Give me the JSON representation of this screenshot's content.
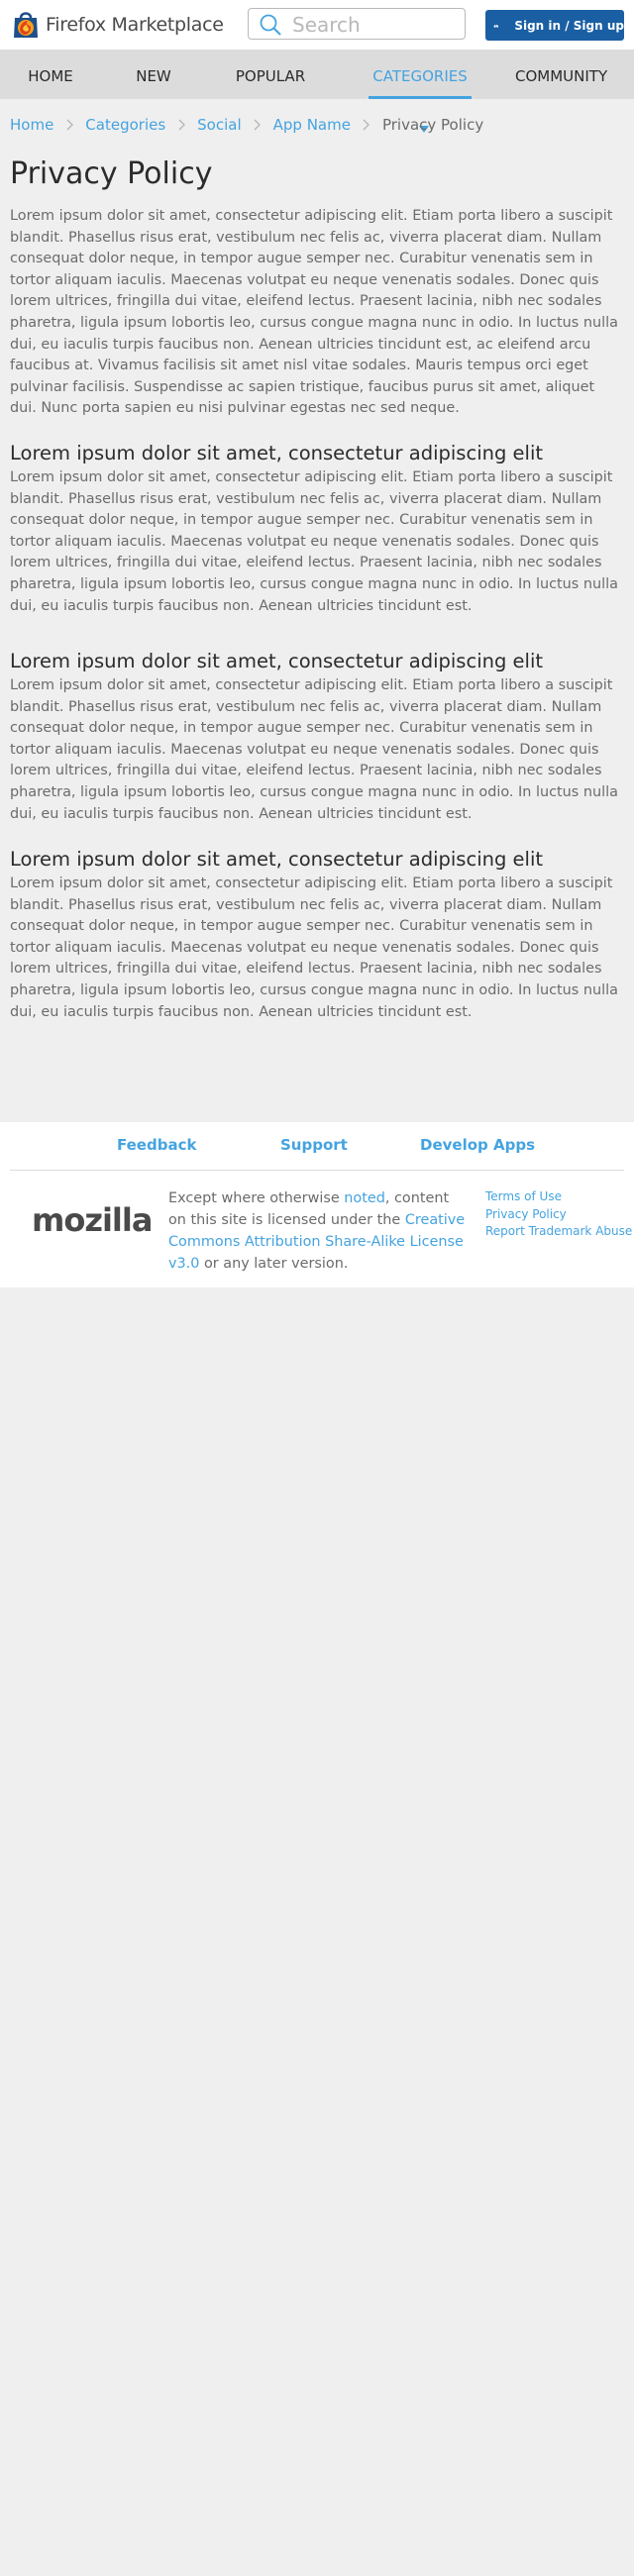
{
  "header": {
    "brand_text": "Firefox Marketplace",
    "search": {
      "placeholder": "Search",
      "value": ""
    },
    "signin_label": "Sign in / Sign up",
    "icons": {
      "logo": "firefox-marketplace-logo",
      "search": "search-icon",
      "signin": "user-cloud-icon"
    }
  },
  "nav": {
    "items": [
      {
        "label": "HOME",
        "active": false
      },
      {
        "label": "NEW",
        "active": false
      },
      {
        "label": "POPULAR",
        "active": false
      },
      {
        "label": "CATEGORIES",
        "active": true,
        "icon": "caret-down-icon"
      },
      {
        "label": "COMMUNITY",
        "active": false
      }
    ]
  },
  "breadcrumb": {
    "items": [
      "Home",
      "Categories",
      "Social",
      "App Name"
    ],
    "current": "Privacy Policy",
    "separator_icon": "chevron-right-icon"
  },
  "content": {
    "title": "Privacy Policy",
    "intro": "Lorem ipsum dolor sit amet, consectetur adipiscing elit. Etiam porta libero a suscipit blandit. Phasellus risus erat, vestibulum nec felis ac, viverra placerat diam. Nullam consequat dolor neque, in tempor augue semper nec. Curabitur venenatis sem in tortor aliquam iaculis. Maecenas volutpat eu neque venenatis sodales. Donec quis lorem ultrices, fringilla dui vitae, eleifend lectus. Praesent lacinia, nibh nec sodales pharetra, ligula ipsum lobortis leo, cursus congue magna nunc in odio. In luctus nulla dui, eu iaculis turpis faucibus non. Aenean ultricies tincidunt est, ac eleifend arcu faucibus at. Vivamus facilisis sit amet nisl vitae sodales. Mauris tempus orci eget pulvinar facilisis. Suspendisse ac sapien tristique, faucibus purus sit amet, aliquet dui. Nunc porta sapien eu nisi pulvinar egestas nec sed neque.",
    "sections": [
      {
        "heading": "Lorem ipsum dolor sit amet, consectetur adipiscing elit",
        "body": "Lorem ipsum dolor sit amet, consectetur adipiscing elit. Etiam porta libero a suscipit blandit. Phasellus risus erat, vestibulum nec felis ac, viverra placerat diam. Nullam consequat dolor neque, in tempor augue semper nec. Curabitur venenatis sem in tortor aliquam iaculis. Maecenas volutpat eu neque venenatis sodales. Donec quis lorem ultrices, fringilla dui vitae, eleifend lectus. Praesent lacinia, nibh nec sodales pharetra, ligula ipsum lobortis leo, cursus congue magna nunc in odio. In luctus nulla dui, eu iaculis turpis faucibus non. Aenean ultricies tincidunt est."
      },
      {
        "heading": "Lorem ipsum dolor sit amet, consectetur adipiscing elit",
        "body": "Lorem ipsum dolor sit amet, consectetur adipiscing elit. Etiam porta libero a suscipit blandit. Phasellus risus erat, vestibulum nec felis ac, viverra placerat diam. Nullam consequat dolor neque, in tempor augue semper nec. Curabitur venenatis sem in tortor aliquam iaculis. Maecenas volutpat eu neque venenatis sodales. Donec quis lorem ultrices, fringilla dui vitae, eleifend lectus. Praesent lacinia, nibh nec sodales pharetra, ligula ipsum lobortis leo, cursus congue magna nunc in odio. In luctus nulla dui, eu iaculis turpis faucibus non. Aenean ultricies tincidunt est."
      },
      {
        "heading": "Lorem ipsum dolor sit amet, consectetur adipiscing elit",
        "body": "Lorem ipsum dolor sit amet, consectetur adipiscing elit. Etiam porta libero a suscipit blandit. Phasellus risus erat, vestibulum nec felis ac, viverra placerat diam. Nullam consequat dolor neque, in tempor augue semper nec. Curabitur venenatis sem in tortor aliquam iaculis. Maecenas volutpat eu neque venenatis sodales. Donec quis lorem ultrices, fringilla dui vitae, eleifend lectus. Praesent lacinia, nibh nec sodales pharetra, ligula ipsum lobortis leo, cursus congue magna nunc in odio. In luctus nulla dui, eu iaculis turpis faucibus non. Aenean ultricies tincidunt est."
      }
    ]
  },
  "footer": {
    "links": [
      "Feedback",
      "Support",
      "Develop Apps"
    ],
    "logo_text": "mozilla",
    "license": {
      "prefix": "Except where otherwise ",
      "noted_link": "noted",
      "middle": ", content on this site is licensed under the ",
      "license_link": "Creative Commons Attribution Share-Alike License v3.0",
      "suffix": " or any later version."
    },
    "legal_links": [
      "Terms of Use",
      "Privacy Policy",
      "Report Trademark Abuse"
    ]
  },
  "colors": {
    "accent": "#45a3e0",
    "signin_button": "#1a5fa3",
    "nav_background": "#dcdcdc",
    "page_background": "#efefef",
    "body_text": "#6b6b6b",
    "heading_text": "#2b2b2b"
  }
}
